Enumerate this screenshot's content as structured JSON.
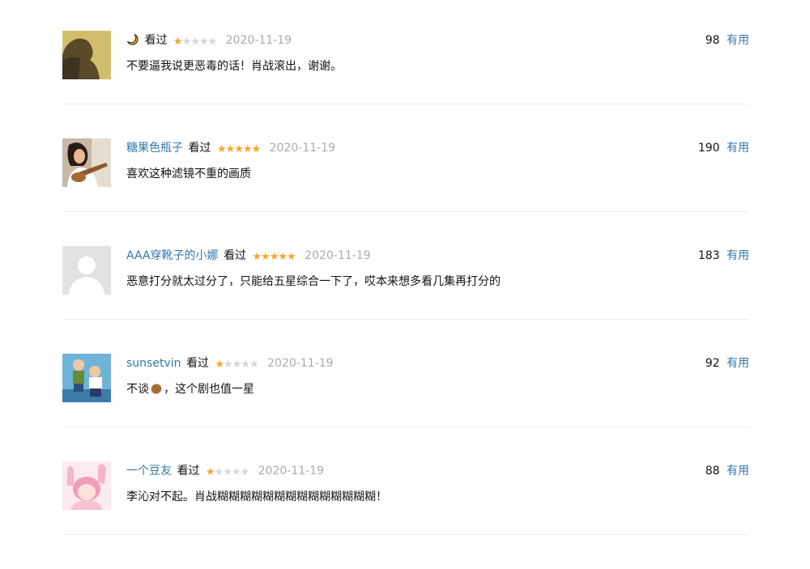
{
  "comments": [
    {
      "user": "",
      "status": "看过",
      "rating": 1,
      "date": "2020-11-19",
      "votes": "98",
      "useful_label": "有用",
      "content": "不要逼我说更恶毒的话！肖战滚出，谢谢。"
    },
    {
      "user": "糖果色瓶子",
      "status": "看过",
      "rating": 5,
      "date": "2020-11-19",
      "votes": "190",
      "useful_label": "有用",
      "content": "喜欢这种滤镜不重的画质"
    },
    {
      "user": "AAA穿靴子的小娜",
      "status": "看过",
      "rating": 5,
      "date": "2020-11-19",
      "votes": "183",
      "useful_label": "有用",
      "content": "恶意打分就太过分了，只能给五星综合一下了，哎本来想多看几集再打分的"
    },
    {
      "user": "sunsetvin",
      "status": "看过",
      "rating": 1,
      "date": "2020-11-19",
      "votes": "92",
      "useful_label": "有用",
      "content_before": "不谈",
      "content_after": "，这个剧也值一星"
    },
    {
      "user": "一个豆友",
      "status": "看过",
      "rating": 1,
      "date": "2020-11-19",
      "votes": "88",
      "useful_label": "有用",
      "content": "李沁对不起。肖战糊糊糊糊糊糊糊糊糊糊糊糊糊糊！"
    }
  ],
  "colors": {
    "link": "#3377aa",
    "star_on": "#f5a623",
    "star_off": "#d6d6d6",
    "date": "#aaaaaa",
    "divider": "#ececec"
  },
  "icons": {
    "star": "star-icon",
    "moon": "moon-icon",
    "potato": "potato-emoji-icon"
  }
}
